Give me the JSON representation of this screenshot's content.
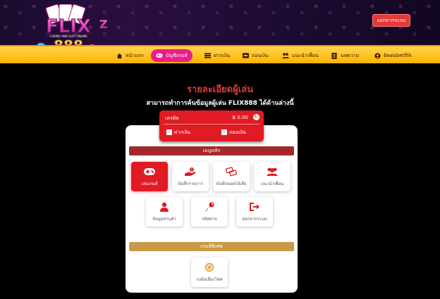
{
  "header": {
    "logo_text": "FLIX888",
    "logo_tagline": "CASINO AND SLOT ONLINE",
    "logout_label": "ออกจากระบบ"
  },
  "nav": [
    {
      "label": "หน้าแรก",
      "icon": "home-icon"
    },
    {
      "label": "บัญชีเกมส์",
      "icon": "gamepad-icon",
      "active": true
    },
    {
      "label": "ฝากเงิน",
      "icon": "deposit-icon"
    },
    {
      "label": "ถอนเงิน",
      "icon": "withdraw-icon"
    },
    {
      "label": "แนะนำเพื่อน",
      "icon": "friends-icon"
    },
    {
      "label": "บทความ",
      "icon": "article-icon"
    },
    {
      "label": "ติดต่อbetflik",
      "icon": "contact-icon"
    }
  ],
  "page": {
    "title": "รายละเอียดผู้เล่น",
    "subtitle": "สามารถทำการค้นข้อมูลผู้เล่น FLIX888 ได้ด้านล่างนี้"
  },
  "credit": {
    "label": "เครดิต",
    "value": "฿ 0.00",
    "deposit_label": "ฝากเงิน",
    "withdraw_label": "ถอนเงิน"
  },
  "main_menu": {
    "title": "เมนูหลัก",
    "items": [
      {
        "label": "เล่นเกมส์",
        "icon": "gamepad-icon",
        "active": true
      },
      {
        "label": "บันทึกรายการ",
        "icon": "hand-coin-icon"
      },
      {
        "label": "บันทึกยอดได้เสีย",
        "icon": "exchange-icon"
      },
      {
        "label": "แนะนำเพื่อน",
        "icon": "users-icon"
      },
      {
        "label": "ข้อมูลส่วนตัว",
        "icon": "user-icon"
      },
      {
        "label": "รหัสผ่าน",
        "icon": "key-icon"
      },
      {
        "label": "ออกจากระบบ",
        "icon": "logout-icon"
      }
    ]
  },
  "special_games": {
    "title": "เกมส์พิเศษ",
    "items": [
      {
        "label": "กงล้อเสี่ยงโชค",
        "icon": "wheel-icon"
      }
    ]
  },
  "colors": {
    "accent": "#e01b24",
    "nav_bg": "#ffc107",
    "active_pink": "#e91e8c",
    "gold_bar": "#c89a46",
    "red_bar": "#a4282a"
  }
}
